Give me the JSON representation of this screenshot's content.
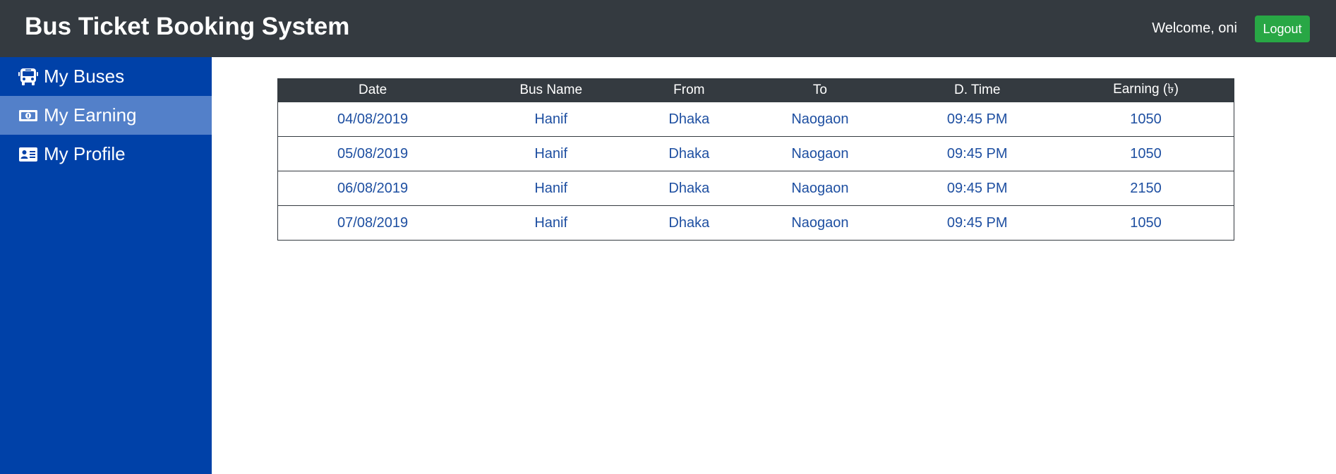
{
  "header": {
    "title": "Bus Ticket Booking System",
    "welcome": "Welcome, oni",
    "logout_label": "Logout",
    "background": "#343a40",
    "logout_color": "#28a745"
  },
  "sidebar": {
    "background": "#0041a8",
    "active_background": "#5380c9",
    "items": [
      {
        "label": "My Buses",
        "icon": "bus-icon",
        "active": false
      },
      {
        "label": "My Earning",
        "icon": "money-bill-icon",
        "active": true
      },
      {
        "label": "My Profile",
        "icon": "id-card-icon",
        "active": false
      }
    ]
  },
  "table": {
    "columns": [
      "Date",
      "Bus Name",
      "From",
      "To",
      "D. Time",
      "Earning (৳)"
    ],
    "rows": [
      [
        "04/08/2019",
        "Hanif",
        "Dhaka",
        "Naogaon",
        "09:45 PM",
        "1050"
      ],
      [
        "05/08/2019",
        "Hanif",
        "Dhaka",
        "Naogaon",
        "09:45 PM",
        "1050"
      ],
      [
        "06/08/2019",
        "Hanif",
        "Dhaka",
        "Naogaon",
        "09:45 PM",
        "2150"
      ],
      [
        "07/08/2019",
        "Hanif",
        "Dhaka",
        "Naogaon",
        "09:45 PM",
        "1050"
      ]
    ]
  }
}
